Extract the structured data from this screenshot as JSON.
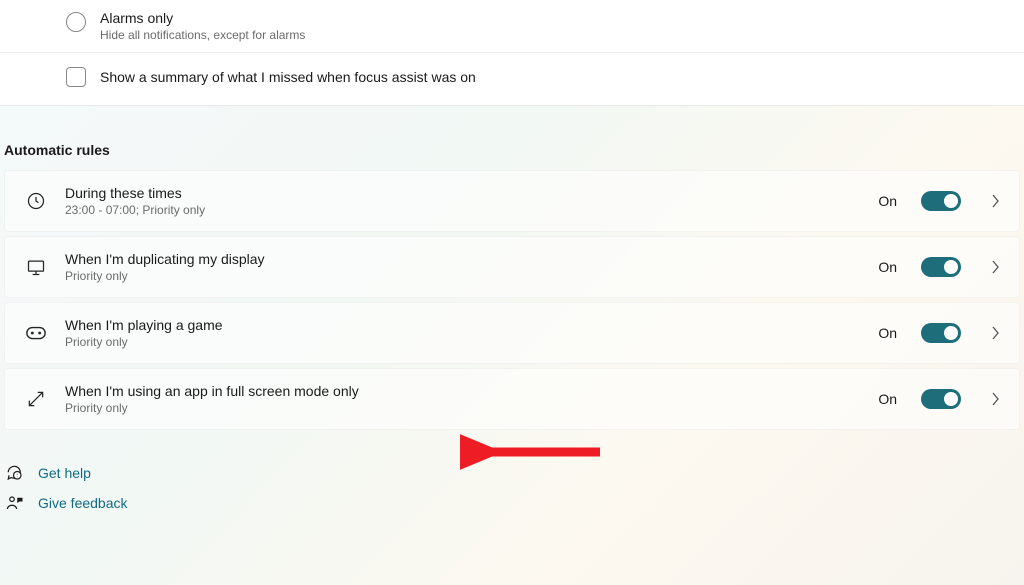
{
  "options": {
    "alarms_only": {
      "title": "Alarms only",
      "subtitle": "Hide all notifications, except for alarms"
    },
    "summary_checkbox": "Show a summary of what I missed when focus assist was on"
  },
  "section_title": "Automatic rules",
  "rules": [
    {
      "title": "During these times",
      "subtitle": "23:00 - 07:00; Priority only",
      "state": "On"
    },
    {
      "title": "When I'm duplicating my display",
      "subtitle": "Priority only",
      "state": "On"
    },
    {
      "title": "When I'm playing a game",
      "subtitle": "Priority only",
      "state": "On"
    },
    {
      "title": "When I'm using an app in full screen mode only",
      "subtitle": "Priority only",
      "state": "On"
    }
  ],
  "links": {
    "help": "Get help",
    "feedback": "Give feedback"
  }
}
